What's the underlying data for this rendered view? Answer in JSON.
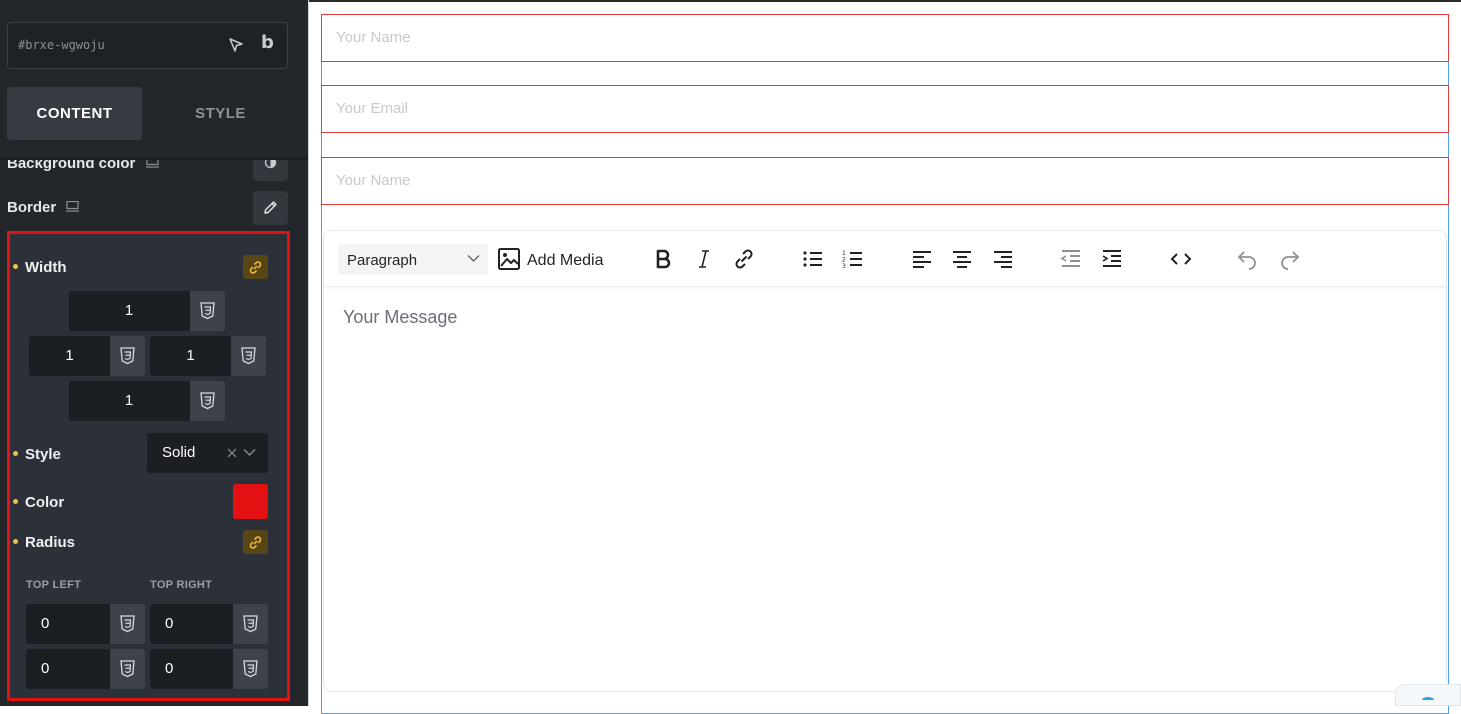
{
  "panel": {
    "element_id": "#brxe-wgwoju",
    "tabs": [
      {
        "label": "CONTENT",
        "active": true
      },
      {
        "label": "STYLE",
        "active": false
      }
    ],
    "background_color_label": "Background color",
    "border_label": "Border",
    "border": {
      "width_label": "Width",
      "width_top": "1",
      "width_left": "1",
      "width_right": "1",
      "width_bottom": "1",
      "style_label": "Style",
      "style_value": "Solid",
      "color_label": "Color",
      "color_value": "#e31111",
      "radius_label": "Radius",
      "top_left_label": "TOP LEFT",
      "top_right_label": "TOP RIGHT",
      "radius_top_left": "0",
      "radius_top_right": "0",
      "radius_bottom_left": "0",
      "radius_bottom_right": "0"
    },
    "accent_dot_color": "#f4c143",
    "highlight_color": "#e31111"
  },
  "canvas": {
    "fields": [
      {
        "placeholder": "Your Name"
      },
      {
        "placeholder": "Your Email"
      },
      {
        "placeholder": "Your Name"
      }
    ],
    "editor": {
      "block_format": "Paragraph",
      "add_media_label": "Add Media",
      "toolbar_icons": [
        "bold-icon",
        "italic-icon",
        "link-icon",
        "bullet-list-icon",
        "numbered-list-icon",
        "align-left-icon",
        "align-center-icon",
        "align-right-icon",
        "outdent-icon",
        "indent-icon",
        "code-icon",
        "undo-icon",
        "redo-icon"
      ],
      "placeholder": "Your Message"
    },
    "field_border_color": "#e03c3c",
    "frame_border_color": "#4ea2e3"
  }
}
